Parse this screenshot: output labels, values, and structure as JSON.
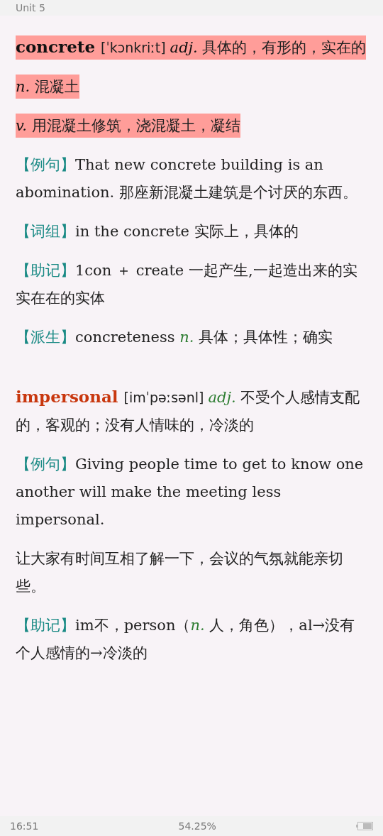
{
  "header": {
    "title": "Unit 5"
  },
  "entries": [
    {
      "paragraphs": [
        {
          "highlighted": true,
          "segments": [
            {
              "kind": "headword",
              "text": "concrete "
            },
            {
              "kind": "phonetic",
              "text": "[ˈkɔnkriːt] "
            },
            {
              "kind": "pos",
              "text": "adj."
            },
            {
              "kind": "text",
              "text": " 具体的，有形的，实在的"
            }
          ]
        },
        {
          "highlighted": true,
          "segments": [
            {
              "kind": "pos",
              "text": "n."
            },
            {
              "kind": "text",
              "text": " 混凝土"
            }
          ]
        },
        {
          "highlighted": true,
          "segments": [
            {
              "kind": "pos",
              "text": "v."
            },
            {
              "kind": "text",
              "text": " 用混凝土修筑，浇混凝土，凝结"
            }
          ]
        },
        {
          "highlighted": false,
          "segments": [
            {
              "kind": "label",
              "text": "【例句】"
            },
            {
              "kind": "text",
              "text": "That new concrete building is an abomination. 那座新混凝土建筑是个讨厌的东西。"
            }
          ]
        },
        {
          "highlighted": false,
          "segments": [
            {
              "kind": "label",
              "text": "【词组】"
            },
            {
              "kind": "text",
              "text": "in the concrete 实际上，具体的"
            }
          ]
        },
        {
          "highlighted": false,
          "segments": [
            {
              "kind": "label",
              "text": "【助记】"
            },
            {
              "kind": "text",
              "text": "1con ＋ create 一起产生,一起造出来的实实在在的实体"
            }
          ]
        },
        {
          "highlighted": false,
          "segments": [
            {
              "kind": "label",
              "text": "【派生】"
            },
            {
              "kind": "text",
              "text": "concreteness "
            },
            {
              "kind": "pos",
              "text": "n."
            },
            {
              "kind": "text",
              "text": " 具体；具体性；确实"
            }
          ]
        }
      ]
    },
    {
      "paragraphs": [
        {
          "highlighted": false,
          "segments": [
            {
              "kind": "headword",
              "text": "impersonal "
            },
            {
              "kind": "phonetic",
              "text": "[imˈpəːsənl] "
            },
            {
              "kind": "pos",
              "text": "adj."
            },
            {
              "kind": "text",
              "text": " 不受个人感情支配的，客观的；没有人情味的，冷淡的"
            }
          ]
        },
        {
          "highlighted": false,
          "segments": [
            {
              "kind": "label",
              "text": "【例句】"
            },
            {
              "kind": "text",
              "text": "Giving people time to get to know one another will make the meeting less impersonal."
            }
          ]
        },
        {
          "highlighted": false,
          "segments": [
            {
              "kind": "text",
              "text": "让大家有时间互相了解一下，会议的气氛就能亲切些。"
            }
          ]
        },
        {
          "highlighted": false,
          "segments": [
            {
              "kind": "label",
              "text": "【助记】"
            },
            {
              "kind": "text",
              "text": "im不，person（"
            },
            {
              "kind": "pos",
              "text": "n."
            },
            {
              "kind": "text",
              "text": " 人，角色），al→没有个人感情的→冷淡的"
            }
          ]
        }
      ]
    }
  ],
  "status_bar": {
    "time": "16:51",
    "progress": "54.25%"
  }
}
